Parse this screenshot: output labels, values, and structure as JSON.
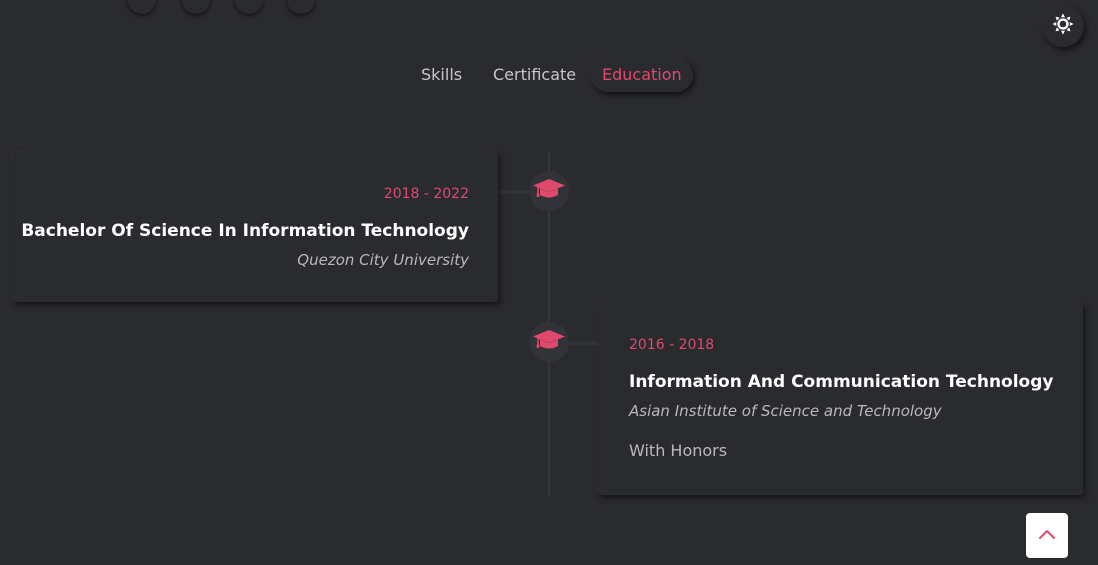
{
  "nav": {
    "tabs": [
      {
        "label": "Skills"
      },
      {
        "label": "Certificate"
      },
      {
        "label": "Education"
      }
    ],
    "active_tab": "Education"
  },
  "theme_toggle": {
    "icon": "sun-icon"
  },
  "education": [
    {
      "date": "2018 - 2022",
      "degree": "Bachelor Of Science In Information Technology",
      "school": "Quezon City University",
      "icon": "graduation-cap-icon"
    },
    {
      "date": "2016 - 2018",
      "degree": "Information And Communication Technology",
      "school": "Asian Institute of Science and Technology",
      "note": "With Honors",
      "icon": "graduation-cap-icon"
    }
  ],
  "scroll_top": {
    "icon": "chevron-up-icon"
  },
  "colors": {
    "background": "#2a2b2f",
    "accent": "#e0496b",
    "heading": "#ffffff",
    "muted": "#b9b9b9"
  }
}
